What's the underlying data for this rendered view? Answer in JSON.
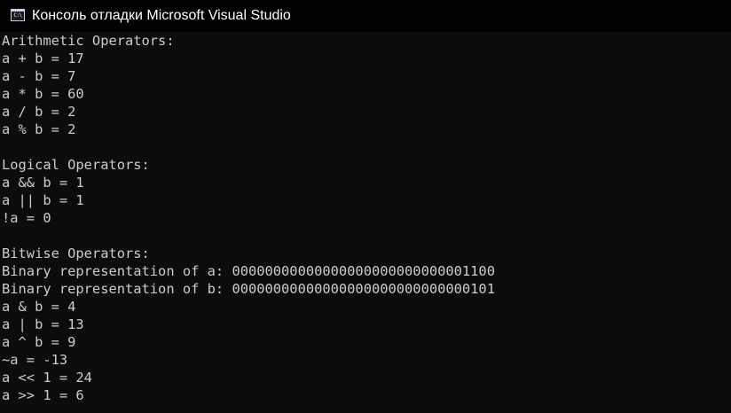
{
  "window": {
    "title": "Консоль отладки Microsoft Visual Studio",
    "icon": "console-app-icon"
  },
  "console": {
    "lines": [
      "Arithmetic Operators:",
      "a + b = 17",
      "a - b = 7",
      "a * b = 60",
      "a / b = 2",
      "a % b = 2",
      "",
      "Logical Operators:",
      "a && b = 1",
      "a || b = 1",
      "!a = 0",
      "",
      "Bitwise Operators:",
      "Binary representation of a: 00000000000000000000000000001100",
      "Binary representation of b: 00000000000000000000000000000101",
      "a & b = 4",
      "a | b = 13",
      "a ^ b = 9",
      "~a = -13",
      "a << 1 = 24",
      "a >> 1 = 6"
    ]
  },
  "colors": {
    "background": "#0c0c0c",
    "titlebar": "#000000",
    "text": "#cccccc"
  }
}
